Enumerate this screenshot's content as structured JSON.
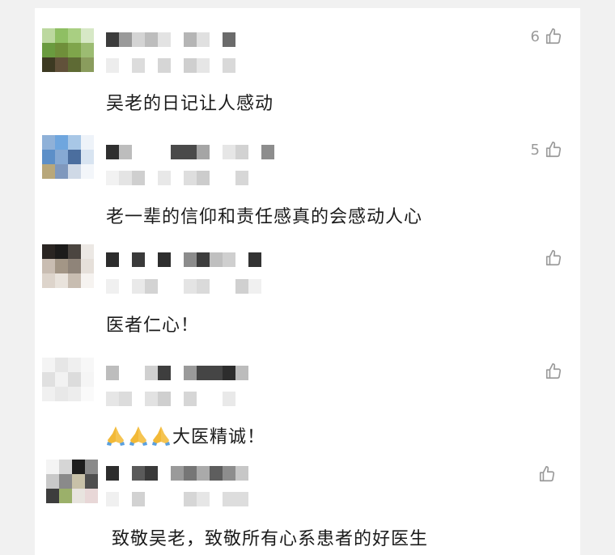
{
  "comments": [
    {
      "text": "吴老的日记让人感动",
      "likes": "6"
    },
    {
      "text": "老一辈的信仰和责任感真的会感动人心",
      "likes": "5"
    },
    {
      "text": "医者仁心！",
      "likes": ""
    },
    {
      "emojis": [
        "pray-hands",
        "pray-hands",
        "pray-hands"
      ],
      "text": "大医精诚！",
      "likes": ""
    },
    {
      "text": "致敬吴老，致敬所有心系患者的好医生",
      "likes": ""
    }
  ],
  "icons": {
    "like": "thumbs-up-outline-icon",
    "emoji": "folded-hands-emoji"
  },
  "colors": {
    "background": "#f1f1f1",
    "card": "#ffffff",
    "text": "#1b1b1b",
    "muted": "#9a9a9a"
  }
}
